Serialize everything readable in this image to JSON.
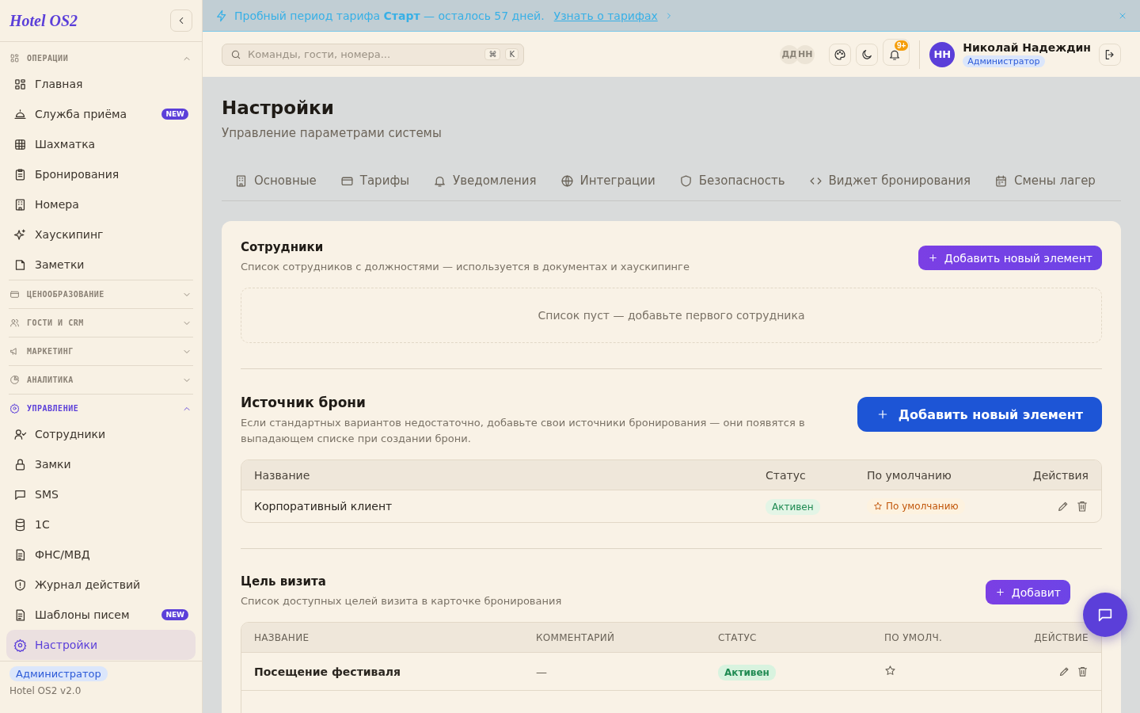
{
  "banner": {
    "text": "Пробный период тарифа **Старт** — осталось 57 дней.",
    "link": "Узнать о тарифах"
  },
  "sidebar": {
    "logo": "Hotel OS2",
    "groups": [
      {
        "title": "ОПЕРАЦИИ",
        "expanded": true,
        "items": [
          {
            "label": "Главная",
            "selected": false
          },
          {
            "label": "Служба приёма",
            "badge": "NEW",
            "selected": false
          },
          {
            "label": "Шахматка",
            "selected": false
          },
          {
            "label": "Бронирования",
            "selected": false
          },
          {
            "label": "Номера",
            "selected": false
          },
          {
            "label": "Хаускипинг",
            "selected": false
          },
          {
            "label": "Заметки",
            "selected": false
          }
        ]
      },
      {
        "title": "ЦЕНООБРАЗОВАНИЕ",
        "expanded": false
      },
      {
        "title": "ГОСТИ И CRM",
        "expanded": false
      },
      {
        "title": "МАРКЕТИНГ",
        "expanded": false
      },
      {
        "title": "АНАЛИТИКА",
        "expanded": false
      },
      {
        "title": "УПРАВЛЕНИЕ",
        "expanded": true,
        "items": [
          {
            "label": "Сотрудники",
            "selected": false
          },
          {
            "label": "Замки",
            "selected": false
          },
          {
            "label": "SMS",
            "selected": false
          },
          {
            "label": "1С",
            "selected": false
          },
          {
            "label": "ФНС/МВД",
            "selected": false
          },
          {
            "label": "Журнал действий",
            "selected": false
          },
          {
            "label": "Шаблоны писем",
            "badge": "NEW",
            "selected": false
          },
          {
            "label": "Настройки",
            "selected": true
          }
        ]
      }
    ],
    "footer": {
      "role": "Администратор",
      "version": "Hotel OS2 v2.0"
    }
  },
  "header": {
    "search": {
      "placeholder": "Команды, гости, номера...",
      "keys": [
        "⌘",
        "K"
      ]
    },
    "presence": [
      "ДД",
      "НН"
    ],
    "notifications": "9+",
    "user": {
      "initials": "НН",
      "name": "Николай Надеждин",
      "role": "Администратор"
    }
  },
  "page": {
    "title": "Настройки",
    "subtitle": "Управление параметрами системы",
    "tabs": [
      {
        "label": "Основные",
        "selected": false
      },
      {
        "label": "Тарифы",
        "selected": false
      },
      {
        "label": "Уведомления",
        "selected": false
      },
      {
        "label": "Интеграции",
        "selected": false
      },
      {
        "label": "Безопасность",
        "selected": false
      },
      {
        "label": "Виджет бронирования",
        "selected": false
      },
      {
        "label": "Смены лагер",
        "selected": false
      }
    ]
  },
  "staff": {
    "title": "Сотрудники",
    "subtitle": "Список сотрудников с должностями — используется в документах и хаускипинге",
    "add_button": "Добавить новый элемент",
    "empty": "Список пуст — добавьте первого сотрудника"
  },
  "sources": {
    "title": "Источник брони",
    "subtitle": "Если стандартных вариантов недостаточно, добавьте свои источники бронирования — они появятся в выпадающем списке при создании брони.",
    "add_button": "Добавить новый элемент",
    "columns": [
      "Название",
      "Статус",
      "По умолчанию",
      "Действия"
    ],
    "rows": [
      {
        "name": "Корпоративный клиент",
        "status": "Активен",
        "default": true,
        "default_label": "По умолчанию"
      }
    ]
  },
  "purposes": {
    "title": "Цель визита",
    "subtitle": "Список доступных целей визита в карточке бронирования",
    "add_button": "Добавит",
    "columns": [
      "НАЗВАНИЕ",
      "КОММЕНТАРИЙ",
      "СТАТУС",
      "ПО УМОЛЧ.",
      "ДЕЙСТВИЕ"
    ],
    "rows": [
      {
        "name": "Посещение фестиваля",
        "comment": "—",
        "status": "Активен",
        "default": false
      }
    ]
  }
}
